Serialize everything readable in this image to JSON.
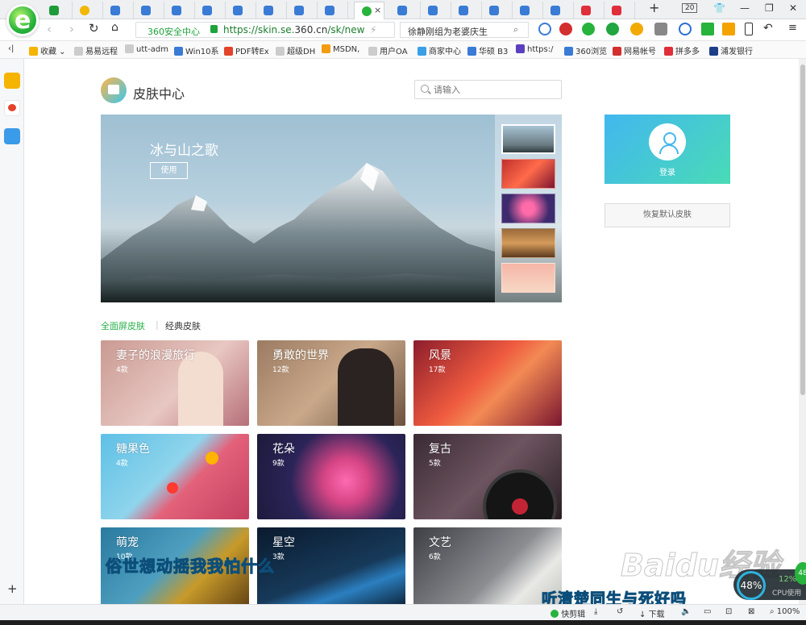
{
  "browser": {
    "tab_count_badge": "20",
    "active_tab_close": "×",
    "address": {
      "security_label": "360安全中心",
      "url_prefix": "https://skin.se.",
      "url_domain": "360.cn",
      "url_path": "/sk/new"
    },
    "search_box": "徐静刚组为老婆庆生",
    "bookmarks": [
      "收藏",
      "易易远程",
      "utt-adm",
      "Win10系",
      "PDF转Ex",
      "超级DH",
      "MSDN,",
      "用户OA",
      "商家中心",
      "华硕 B3",
      "https:/",
      "360浏览",
      "网易帐号",
      "拼多多",
      "浦发银行"
    ],
    "status": {
      "quick_clip": "快剪辑",
      "download": "下载",
      "zoom": "100%"
    }
  },
  "page": {
    "title": "皮肤中心",
    "search_placeholder": "请输入",
    "hero": {
      "title": "冰与山之歌",
      "button": "使用"
    },
    "category_tabs": [
      "全面屏皮肤",
      "经典皮肤"
    ],
    "cards": [
      {
        "title": "妻子的浪漫旅行",
        "count": "4款"
      },
      {
        "title": "勇敢的世界",
        "count": "12款"
      },
      {
        "title": "风景",
        "count": "17款"
      },
      {
        "title": "糖果色",
        "count": "4款"
      },
      {
        "title": "花朵",
        "count": "9款"
      },
      {
        "title": "复古",
        "count": "5款"
      },
      {
        "title": "萌宠",
        "count": "10款"
      },
      {
        "title": "星空",
        "count": "3款"
      },
      {
        "title": "文艺",
        "count": "6款"
      }
    ],
    "login": "登录",
    "reset_button": "恢复默认皮肤"
  },
  "overlays": {
    "subtitle_1": "俗世想动摇我我怕什么",
    "subtitle_2": "听清楚同生与死好吗",
    "watermark": "Baidu经验",
    "cpu": {
      "ring": "48%",
      "percent": "12%",
      "label": "CPU使用"
    },
    "badge": "48"
  },
  "colors": {
    "accent": "#2ab24a",
    "login_gradient_start": "#42b7ef",
    "login_gradient_end": "#49dbb6"
  }
}
